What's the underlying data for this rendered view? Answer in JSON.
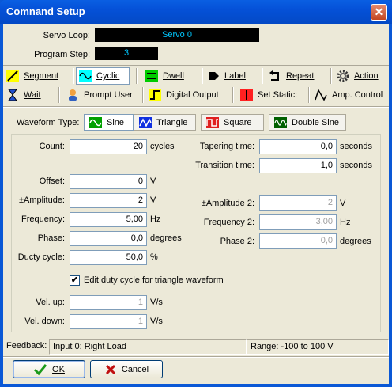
{
  "window": {
    "title": "Comnand Setup",
    "close_glyph": "✕"
  },
  "header": {
    "servo_loop_label": "Servo Loop:",
    "servo_loop_value": "Servo 0",
    "program_step_label": "Program Step:",
    "program_step_value": "3"
  },
  "commands": [
    {
      "label": "Segment",
      "icon": "segment-icon"
    },
    {
      "label": "Cyclic",
      "icon": "cyclic-icon"
    },
    {
      "label": "Dwell",
      "icon": "dwell-icon"
    },
    {
      "label": "Label",
      "icon": "label-icon"
    },
    {
      "label": "Repeat",
      "icon": "repeat-icon"
    },
    {
      "label": "Action",
      "icon": "gear-icon"
    },
    {
      "label": "Wait",
      "icon": "hourglass-icon"
    },
    {
      "label": "Prompt User",
      "icon": "user-icon"
    },
    {
      "label": "Digital Output",
      "icon": "digital-output-icon"
    },
    {
      "label": "Set Static:",
      "icon": "set-static-icon"
    },
    {
      "label": "Amp. Control",
      "icon": "amp-control-icon"
    }
  ],
  "waveform": {
    "label": "Waveform Type:",
    "options": [
      "Sine",
      "Triangle",
      "Square",
      "Double Sine"
    ],
    "selected": "Sine"
  },
  "fields": {
    "count": {
      "label": "Count:",
      "value": "20",
      "unit": "cycles"
    },
    "offset": {
      "label": "Offset:",
      "value": "0",
      "unit": "V"
    },
    "amplitude": {
      "label": "±Amplitude:",
      "value": "2",
      "unit": "V"
    },
    "frequency": {
      "label": "Frequency:",
      "value": "5,00",
      "unit": "Hz"
    },
    "phase": {
      "label": "Phase:",
      "value": "0,0",
      "unit": "degrees"
    },
    "duty": {
      "label": "Ducty cycle:",
      "value": "50,0",
      "unit": "%"
    },
    "tapering": {
      "label": "Tapering time:",
      "value": "0,0",
      "unit": "seconds"
    },
    "transition": {
      "label": "Transition time:",
      "value": "1,0",
      "unit": "seconds"
    },
    "amplitude2": {
      "label": "±Amplitude 2:",
      "value": "2",
      "unit": "V"
    },
    "frequency2": {
      "label": "Frequency 2:",
      "value": "3,00",
      "unit": "Hz"
    },
    "phase2": {
      "label": "Phase 2:",
      "value": "0,0",
      "unit": "degrees"
    },
    "vel_up": {
      "label": "Vel. up:",
      "value": "1",
      "unit": "V/s"
    },
    "vel_down": {
      "label": "Vel. down:",
      "value": "1",
      "unit": "V/s"
    }
  },
  "duty_checkbox": {
    "label": "Edit duty cycle for triangle waveform",
    "checked": true,
    "mark": "✔"
  },
  "status": {
    "feedback_label": "Feedback:",
    "feedback_value": "Input 0: Right Load",
    "range": "Range: -100 to 100 V"
  },
  "buttons": {
    "ok": "OK",
    "cancel": "Cancel"
  }
}
